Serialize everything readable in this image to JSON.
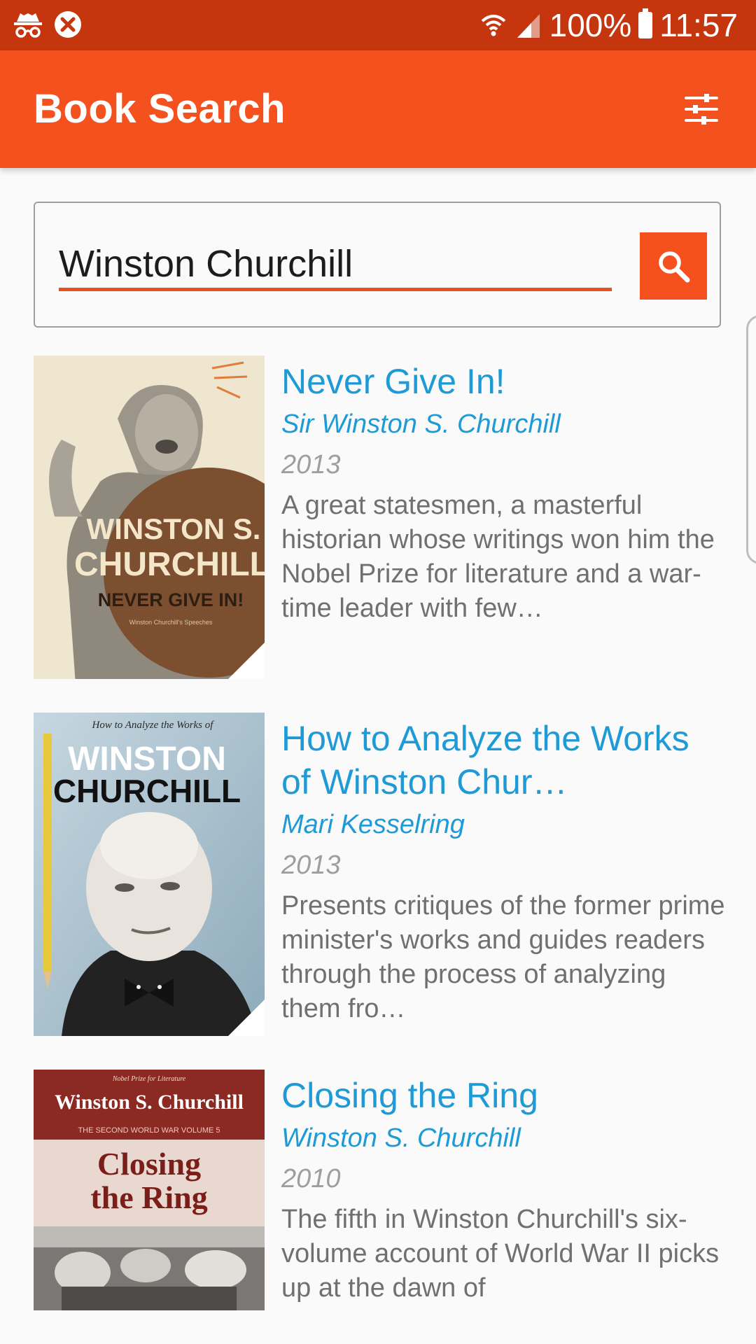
{
  "status_bar": {
    "left_icons": [
      "incognito-icon",
      "blocked-icon"
    ],
    "battery": "100%",
    "time": "11:57"
  },
  "app_bar": {
    "title": "Book Search",
    "filter_icon": "sliders-icon"
  },
  "search": {
    "query": "Winston Churchill",
    "button_icon": "search-icon"
  },
  "colors": {
    "accent": "#f4511e",
    "status_bar": "#c5360f",
    "link": "#1e9ad6"
  },
  "results": [
    {
      "title": "Never Give In!",
      "author": "Sir Winston S. Churchill",
      "year": "2013",
      "description": "A great statesmen, a masterful historian whose writings won him the Nobel Prize for literature and a war-time leader with few…",
      "cover": {
        "line1": "WINSTON S.",
        "line2": "CHURCHILL",
        "line3": "NEVER GIVE IN!",
        "line4": "Winston Churchill's Speeches"
      }
    },
    {
      "title": "How to Analyze the Works of Winston Chur…",
      "author": "Mari Kesselring",
      "year": "2013",
      "description": "Presents critiques of the former prime minister's works and guides readers through the process of analyzing them fro…",
      "cover": {
        "line1": "How to Analyze the Works of",
        "line2": "WINSTON",
        "line3": "CHURCHILL"
      }
    },
    {
      "title": "Closing the Ring",
      "author": "Winston S. Churchill",
      "year": "2010",
      "description": "The fifth in Winston Churchill's six-volume account of World War II picks up at the dawn of",
      "cover": {
        "line1": "Nobel Prize for Literature",
        "line2": "Winston S. Churchill",
        "line3": "THE SECOND WORLD WAR VOLUME 5",
        "line4": "Closing",
        "line5": "the Ring"
      }
    }
  ]
}
